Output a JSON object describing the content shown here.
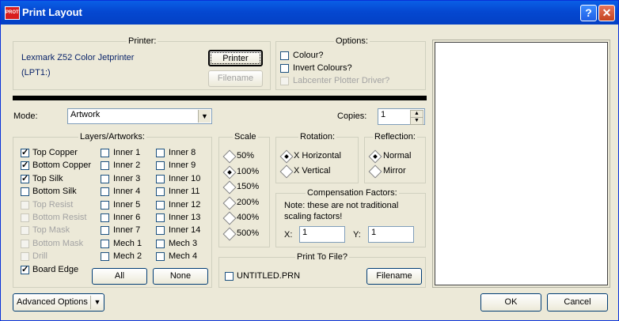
{
  "window": {
    "title": "Print Layout",
    "app_icon_text": "PROTEUS"
  },
  "printer": {
    "legend": "Printer:",
    "name": "Lexmark Z52 Color Jetprinter",
    "port": "(LPT1:)",
    "printer_button": "Printer",
    "filename_button": "Filename"
  },
  "options": {
    "legend": "Options:",
    "colour": "Colour?",
    "invert": "Invert Colours?",
    "labcenter": "Labcenter Plotter Driver?"
  },
  "mode": {
    "label": "Mode:",
    "value": "Artwork"
  },
  "copies": {
    "label": "Copies:",
    "value": "1"
  },
  "layers": {
    "legend": "Layers/Artworks:",
    "col1": [
      {
        "label": "Top Copper",
        "checked": true,
        "enabled": true
      },
      {
        "label": "Bottom Copper",
        "checked": true,
        "enabled": true
      },
      {
        "label": "Top Silk",
        "checked": true,
        "enabled": true
      },
      {
        "label": "Bottom Silk",
        "checked": false,
        "enabled": true
      },
      {
        "label": "Top Resist",
        "checked": false,
        "enabled": false
      },
      {
        "label": "Bottom Resist",
        "checked": false,
        "enabled": false
      },
      {
        "label": "Top Mask",
        "checked": false,
        "enabled": false
      },
      {
        "label": "Bottom Mask",
        "checked": false,
        "enabled": false
      },
      {
        "label": "Drill",
        "checked": false,
        "enabled": false
      },
      {
        "label": "Board Edge",
        "checked": true,
        "enabled": true
      }
    ],
    "col2": [
      "Inner 1",
      "Inner 2",
      "Inner 3",
      "Inner 4",
      "Inner 5",
      "Inner 6",
      "Inner 7",
      "Mech 1",
      "Mech 2"
    ],
    "col3": [
      "Inner 8",
      "Inner 9",
      "Inner 10",
      "Inner 11",
      "Inner 12",
      "Inner 13",
      "Inner 14",
      "Mech 3",
      "Mech 4"
    ],
    "all_button": "All",
    "none_button": "None"
  },
  "scale": {
    "legend": "Scale",
    "options": [
      "50%",
      "100%",
      "150%",
      "200%",
      "400%",
      "500%"
    ],
    "selected": "100%"
  },
  "rotation": {
    "legend": "Rotation:",
    "horizontal": "X Horizontal",
    "vertical": "X Vertical",
    "selected": "X Horizontal"
  },
  "reflection": {
    "legend": "Reflection:",
    "normal": "Normal",
    "mirror": "Mirror",
    "selected": "Normal"
  },
  "compensation": {
    "legend": "Compensation Factors:",
    "note_line1": "Note: these are not traditional",
    "note_line2": "scaling factors!",
    "x_label": "X:",
    "x_value": "1",
    "y_label": "Y:",
    "y_value": "1"
  },
  "print_to_file": {
    "legend": "Print To File?",
    "filename": "UNTITLED.PRN",
    "button": "Filename"
  },
  "footer": {
    "advanced": "Advanced Options",
    "ok": "OK",
    "cancel": "Cancel"
  }
}
